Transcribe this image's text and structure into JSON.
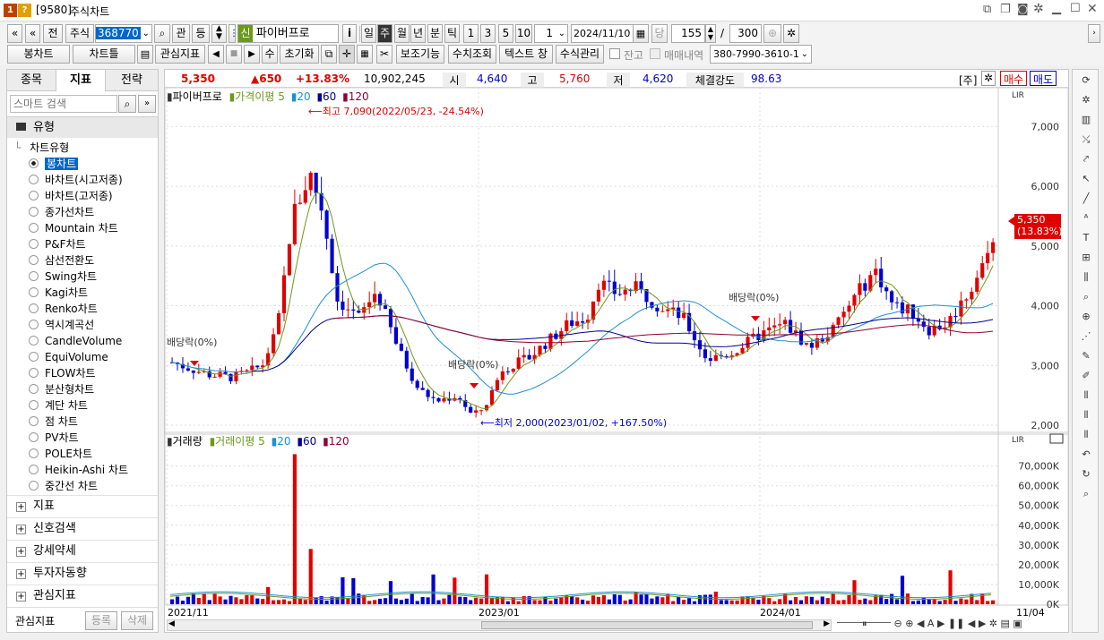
{
  "window": {
    "code": "[9580]",
    "title": "주식차트",
    "icons": [
      "new-window-icon",
      "copy-icon",
      "camera-icon",
      "settings-icon",
      "minimize-icon",
      "maximize-icon",
      "close-icon"
    ]
  },
  "toolbar1": {
    "labels": [
      "전",
      "주식"
    ],
    "code_value": "368770",
    "actions": [
      "관",
      "등"
    ],
    "flag": "신",
    "name": "파이버프로",
    "info": "i",
    "periods": [
      "일",
      "주",
      "월",
      "년",
      "분",
      "틱"
    ],
    "active_period": "주",
    "minutes": [
      "1",
      "3",
      "5",
      "10"
    ],
    "minute_select": "1",
    "date": "2024/11/10",
    "today": "당",
    "count": "155",
    "slash": "/",
    "max": "300"
  },
  "toolbar2": {
    "chart_type": "봉차트",
    "chart_frame": "차트틀",
    "interest": "관심지표",
    "su": "수",
    "reset": "초기화",
    "aux": "보조기능",
    "query": "수치조회",
    "text_window": "텍스트 창",
    "formula": "수식관리",
    "balance": "잔고",
    "trades": "매매내역",
    "account": "380-7990-3610-1"
  },
  "sidebar": {
    "tabs": [
      "종목",
      "지표",
      "전략"
    ],
    "active_tab": "지표",
    "search_placeholder": "스마트 검색",
    "type_header": "유형",
    "tree_header": "차트유형",
    "items": [
      "봉차트",
      "바차트(시고저종)",
      "바차트(고저종)",
      "종가선차트",
      "Mountain 차트",
      "P&F차트",
      "삼선전환도",
      "Swing차트",
      "Kagi차트",
      "Renko차트",
      "역시계곡선",
      "CandleVolume",
      "EquiVolume",
      "FLOW차트",
      "분산형차트",
      "계단 차트",
      "점 차트",
      "PV차트",
      "POLE차트",
      "Heikin-Ashi 차트",
      "중간선 차트"
    ],
    "selected": "봉차트",
    "groups": [
      "지표",
      "신호검색",
      "강세약세",
      "투자자동향",
      "관심지표"
    ],
    "footer_label": "관심지표",
    "register": "등록",
    "delete": "삭제"
  },
  "quote": {
    "price": "5,350",
    "change": "▲650",
    "pct": "+13.83%",
    "volume": "10,902,245",
    "open_label": "시",
    "open": "4,640",
    "high_label": "고",
    "high": "5,760",
    "low_label": "저",
    "low": "4,620",
    "strength_label": "체결강도",
    "strength": "98.63",
    "mode": "[주]",
    "buy": "매수",
    "sell": "매도",
    "colors": {
      "up": "#e00000",
      "down": "#0000d0"
    }
  },
  "price_legend": {
    "name": "파이버프로",
    "ma_label": "가격이평",
    "periods": [
      "5",
      "20",
      "60",
      "120"
    ],
    "colors": [
      "#6a9a1a",
      "#1e8fd0",
      "#000090",
      "#900030"
    ]
  },
  "volume_legend": {
    "name": "거래량",
    "ma_label": "거래이평",
    "periods": [
      "5",
      "20",
      "60",
      "120"
    ]
  },
  "annotations": {
    "high": "⟵최고 7,090(2022/05/23, -24.54%)",
    "low": "⟵최저 2,000(2023/01/02, +167.50%)",
    "dividend": "배당락(0%)"
  },
  "last_price_tag": {
    "price": "5,350",
    "pct": "(13.83%)"
  },
  "x_labels": [
    "2021/11",
    "2023/01",
    "2024/01",
    "11/04"
  ],
  "chart_data": {
    "type": "candlestick",
    "price_axis": [
      "7,000",
      "6,000",
      "5,000",
      "4,000",
      "3,000",
      "2,000"
    ],
    "price_ticks": [
      7000,
      6000,
      5000,
      4000,
      3000,
      2000
    ],
    "ylim": [
      1880,
      7500
    ],
    "volume_axis": [
      "70,000K",
      "60,000K",
      "50,000K",
      "40,000K",
      "30,000K",
      "20,000K",
      "10,000K",
      "0K"
    ],
    "volume_ticks": [
      70000,
      60000,
      50000,
      40000,
      30000,
      20000,
      10000,
      0
    ],
    "vlim": [
      0,
      78000
    ],
    "n_bars": 155
  }
}
